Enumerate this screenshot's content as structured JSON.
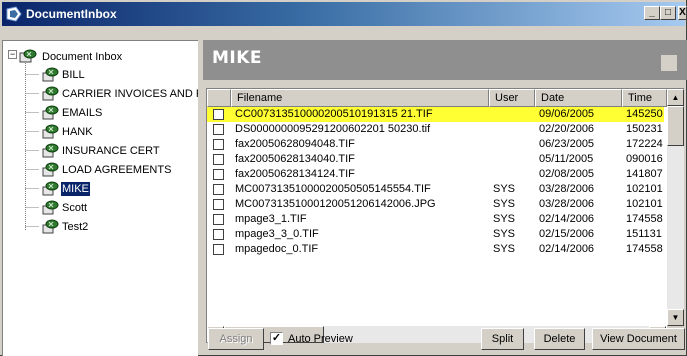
{
  "window": {
    "title": "DocumentInbox",
    "controls": {
      "minimize": "_",
      "maximize": "□",
      "close": "X"
    }
  },
  "tree": {
    "root": {
      "label": "Document Inbox",
      "expander": "−"
    },
    "items": [
      {
        "label": "BILL"
      },
      {
        "label": "CARRIER INVOICES AND FREIGHT"
      },
      {
        "label": "EMAILS"
      },
      {
        "label": "HANK"
      },
      {
        "label": "INSURANCE CERT"
      },
      {
        "label": "LOAD AGREEMENTS"
      },
      {
        "label": "MIKE",
        "selected": true
      },
      {
        "label": "Scott"
      },
      {
        "label": "Test2"
      }
    ]
  },
  "header": {
    "title": "MIKE"
  },
  "list": {
    "columns": [
      {
        "label": "Filename"
      },
      {
        "label": "User"
      },
      {
        "label": "Date"
      },
      {
        "label": "Time"
      }
    ],
    "rows": [
      {
        "filename": "CC007313510000200510191315 21.TIF",
        "user": "",
        "date": "09/06/2005",
        "time": "145250",
        "highlighted": true
      },
      {
        "filename": "DS0000000095291200602201 50230.tif",
        "user": "",
        "date": "02/20/2006",
        "time": "150231"
      },
      {
        "filename": "fax20050628094048.TIF",
        "user": "",
        "date": "06/23/2005",
        "time": "172224"
      },
      {
        "filename": "fax20050628134040.TIF",
        "user": "",
        "date": "05/11/2005",
        "time": "090016"
      },
      {
        "filename": "fax20050628134124.TIF",
        "user": "",
        "date": "02/08/2005",
        "time": "141807"
      },
      {
        "filename": "MC00731351000020050505145554.TIF",
        "user": "SYS",
        "date": "03/28/2006",
        "time": "102101"
      },
      {
        "filename": "MC00731351000120051206142006.JPG",
        "user": "SYS",
        "date": "03/28/2006",
        "time": "102101"
      },
      {
        "filename": "mpage3_1.TIF",
        "user": "SYS",
        "date": "02/14/2006",
        "time": "174558"
      },
      {
        "filename": "mpage3_3_0.TIF",
        "user": "SYS",
        "date": "02/15/2006",
        "time": "151131"
      },
      {
        "filename": "mpagedoc_0.TIF",
        "user": "SYS",
        "date": "02/14/2006",
        "time": "174558"
      }
    ],
    "scroll": {
      "up": "▲",
      "down": "▼",
      "left": "◀",
      "right": "▶"
    }
  },
  "toolbar": {
    "assign_label": "Assign",
    "auto_preview_label": "Auto Preview",
    "auto_preview_checked": "✓",
    "split_label": "Split",
    "delete_label": "Delete",
    "view_document_label": "View Document"
  },
  "colors": {
    "title_gradient_start": "#0a246a",
    "highlight_row": "#ffff33",
    "header_band": "#8f8f8f",
    "selection": "#0a246a"
  }
}
